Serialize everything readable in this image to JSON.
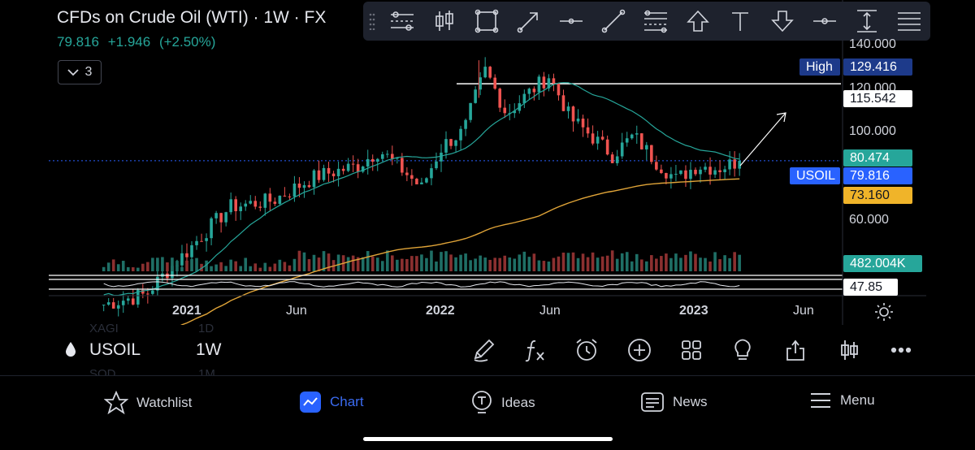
{
  "header": {
    "title": "CFDs on Crude Oil (WTI) · 1W · FX",
    "last": "79.816",
    "change": "+1.946",
    "change_pct": "(+2.50%)",
    "indicators_count": "3"
  },
  "toolbar": {
    "tools": [
      "settings-lines-icon",
      "candles-icon",
      "rectangle-icon",
      "arrow-tool-icon",
      "horizontal-line-icon",
      "trend-line-icon",
      "fib-lines-icon",
      "arrow-up-icon",
      "text-tool-icon",
      "arrow-down-icon",
      "horizontal-ray-icon",
      "price-range-icon",
      "menu-icon"
    ]
  },
  "price_axis": {
    "ticks": [
      "140.000",
      "120.000",
      "100.000",
      "60.000"
    ],
    "high_label": "High",
    "high_value": "129.416",
    "hline_value": "115.542",
    "ma20_value": "80.474",
    "symbol_tag": "USOIL",
    "last_value": "79.816",
    "ma200_value": "73.160",
    "volume_value": "482.004K",
    "rsi_value": "47.85"
  },
  "time_axis": {
    "labels": [
      {
        "text": "2021",
        "bold": true
      },
      {
        "text": "Jun",
        "bold": false
      },
      {
        "text": "2022",
        "bold": true
      },
      {
        "text": "Jun",
        "bold": false
      },
      {
        "text": "2023",
        "bold": true
      },
      {
        "text": "Jun",
        "bold": false
      }
    ]
  },
  "symbol_bar": {
    "symbol": "USOIL",
    "interval": "1W",
    "ghost_top_left": "XAGI",
    "ghost_top_right": "1D",
    "ghost_bottom_left": "SOD",
    "ghost_bottom_right": "1M"
  },
  "nav": {
    "watchlist": "Watchlist",
    "chart": "Chart",
    "ideas": "Ideas",
    "news": "News",
    "menu": "Menu"
  },
  "colors": {
    "up": "#26a69a",
    "down": "#ef5350",
    "ma20": "#26a69a",
    "ma200": "#e0a438",
    "accent": "#2962ff",
    "nav_active": "#3b6bf0"
  },
  "chart_data": {
    "type": "candlestick",
    "interval": "1W",
    "x_range": [
      "2020-09",
      "2023-03"
    ],
    "y_scale": "log",
    "y_ticks": [
      60,
      100,
      120,
      140
    ],
    "close_path": [
      [
        "2020-09",
        40
      ],
      [
        "2020-11",
        42
      ],
      [
        "2021-01",
        52
      ],
      [
        "2021-03",
        64
      ],
      [
        "2021-05",
        66
      ],
      [
        "2021-07",
        74
      ],
      [
        "2021-09",
        78
      ],
      [
        "2021-10",
        84
      ],
      [
        "2021-12",
        70
      ],
      [
        "2022-01",
        86
      ],
      [
        "2022-02",
        92
      ],
      [
        "2022-03",
        123
      ],
      [
        "2022-04",
        100
      ],
      [
        "2022-05",
        110
      ],
      [
        "2022-06",
        120
      ],
      [
        "2022-07",
        98
      ],
      [
        "2022-08",
        90
      ],
      [
        "2022-09",
        82
      ],
      [
        "2022-10",
        90
      ],
      [
        "2022-11",
        80
      ],
      [
        "2022-12",
        73
      ],
      [
        "2023-01",
        78
      ],
      [
        "2023-02",
        77
      ],
      [
        "2023-03",
        79.8
      ]
    ],
    "high": 129.416,
    "horizontal_line": 115.542,
    "ma_short_last": 80.474,
    "ma_long_last": 73.16,
    "last_close": 79.816,
    "volume_last": "482.004K",
    "rsi_last": 47.85
  }
}
